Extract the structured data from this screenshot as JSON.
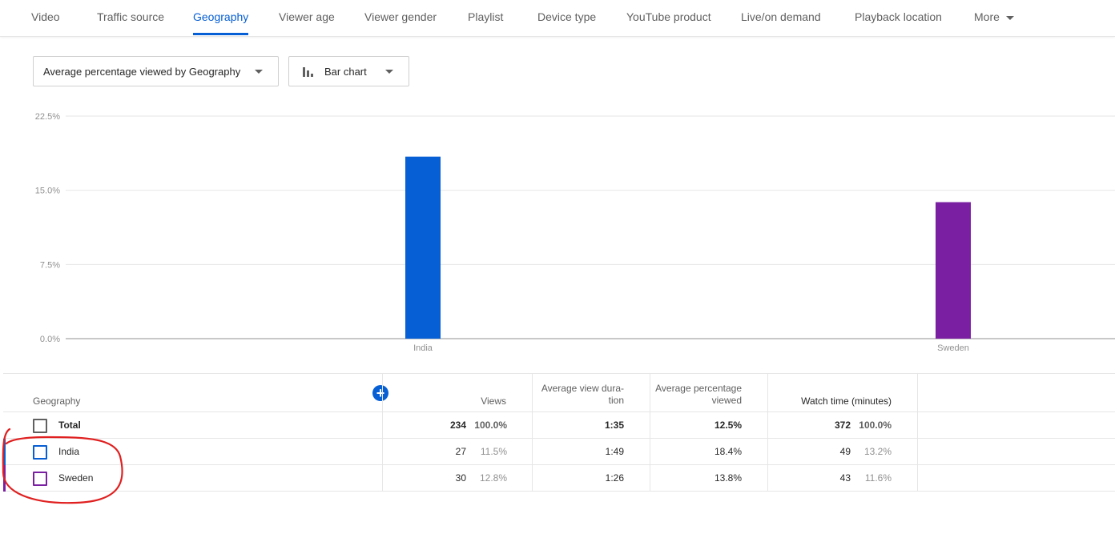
{
  "tabs": [
    {
      "label": "Video"
    },
    {
      "label": "Traffic source"
    },
    {
      "label": "Geography",
      "active": true
    },
    {
      "label": "Viewer age"
    },
    {
      "label": "Viewer gender"
    },
    {
      "label": "Playlist"
    },
    {
      "label": "Device type"
    },
    {
      "label": "YouTube product"
    },
    {
      "label": "Live/on demand"
    },
    {
      "label": "Playback location"
    },
    {
      "label": "More"
    }
  ],
  "controls": {
    "metric_select": "Average percentage viewed by Geography",
    "chart_type_select": "Bar chart",
    "chart_type_icon": "bar-chart-icon",
    "add_metric_icon": "plus-icon"
  },
  "colors": {
    "accent": "#065fd4",
    "india": "#065fd4",
    "sweden": "#7b1fa2"
  },
  "chart_data": {
    "type": "bar",
    "categories": [
      "India",
      "Sweden"
    ],
    "values": [
      18.4,
      13.8
    ],
    "colors": [
      "#065fd4",
      "#7b1fa2"
    ],
    "ylim": [
      0,
      22.5
    ],
    "yticks": [
      "22.5%",
      "15.0%",
      "7.5%",
      "0.0%"
    ],
    "grid": true
  },
  "table": {
    "headers": {
      "geography": "Geography",
      "views": "Views",
      "avg_view_duration_1": "Average view dura-",
      "avg_view_duration_2": "tion",
      "avg_pct_viewed_1": "Average percentage",
      "avg_pct_viewed_2": "viewed",
      "watch_time": "Watch time (minutes)"
    },
    "rows": [
      {
        "name": "Total",
        "views": "234",
        "views_pct": "100.0%",
        "duration": "1:35",
        "avg_pct": "12.5%",
        "watch": "372",
        "watch_pct": "100.0%"
      },
      {
        "name": "India",
        "views": "27",
        "views_pct": "11.5%",
        "duration": "1:49",
        "avg_pct": "18.4%",
        "watch": "49",
        "watch_pct": "13.2%"
      },
      {
        "name": "Sweden",
        "views": "30",
        "views_pct": "12.8%",
        "duration": "1:26",
        "avg_pct": "13.8%",
        "watch": "43",
        "watch_pct": "11.6%"
      }
    ]
  }
}
